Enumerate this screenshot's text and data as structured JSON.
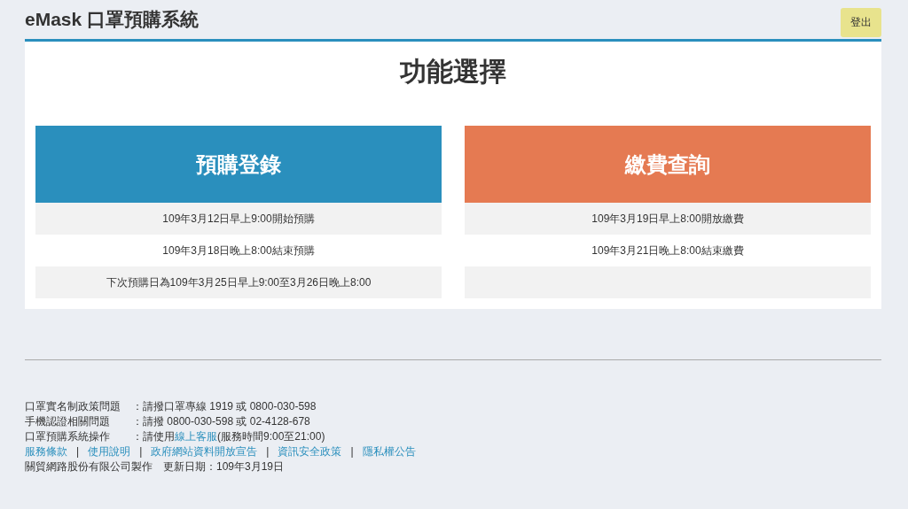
{
  "header": {
    "title": "eMask 口罩預購系統",
    "logout": "登出"
  },
  "panel": {
    "title": "功能選擇"
  },
  "cards": [
    {
      "title": "預購登錄",
      "color": "#2a8fbd",
      "rows": [
        "109年3月12日早上9:00開始預購",
        "109年3月18日晚上8:00結束預購",
        "下次預購日為109年3月25日早上9:00至3月26日晚上8:00"
      ]
    },
    {
      "title": "繳費查詢",
      "color": "#e57a52",
      "rows": [
        "109年3月19日早上8:00開放繳費",
        "109年3月21日晚上8:00結束繳費"
      ]
    }
  ],
  "footer": {
    "contacts": [
      {
        "label": "口罩實名制政策問題",
        "value": "：請撥口罩專線 1919 或 0800-030-598"
      },
      {
        "label": "手機認證相關問題",
        "value": "：請撥 0800-030-598 或 02-4128-678"
      },
      {
        "label": "口罩預購系統操作",
        "value": "：請使用",
        "link": "線上客服",
        "after": "(服務時間9:00至21:00)"
      }
    ],
    "separator": "|",
    "links": [
      "服務條款",
      "使用說明",
      "政府網站資料開放宣告",
      "資訊安全政策",
      "隱私權公告"
    ],
    "credit": "關貿網路股份有限公司製作　更新日期：109年3月19日"
  }
}
